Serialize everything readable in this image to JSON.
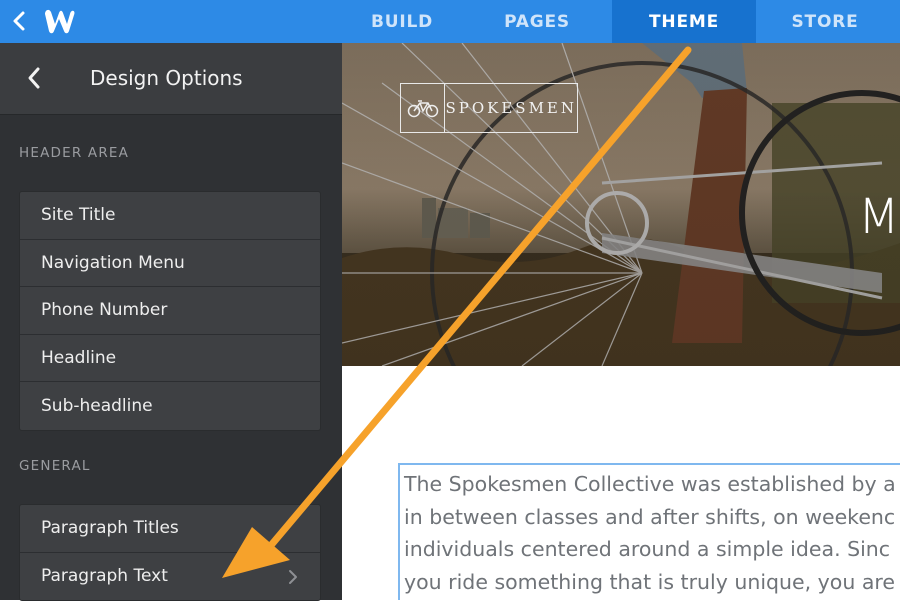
{
  "topbar": {
    "tabs": [
      {
        "label": "BUILD",
        "active": false
      },
      {
        "label": "PAGES",
        "active": false
      },
      {
        "label": "THEME",
        "active": true
      },
      {
        "label": "STORE",
        "active": false
      }
    ],
    "logo_icon": "weebly-w-icon",
    "back_icon": "chevron-left-icon"
  },
  "sidebar": {
    "title": "Design Options",
    "back_icon": "chevron-left-icon",
    "sections": [
      {
        "label": "HEADER AREA",
        "items": [
          "Site Title",
          "Navigation Menu",
          "Phone Number",
          "Headline",
          "Sub-headline"
        ]
      },
      {
        "label": "GENERAL",
        "items": [
          "Paragraph Titles",
          "Paragraph Text"
        ],
        "selected_item_chevron": "chevron-right-icon"
      }
    ]
  },
  "content": {
    "site_logo_text": "SPOKESMEN",
    "site_logo_icon": "bicycle-icon",
    "hero_heading_partial": "M",
    "paragraph_lines": [
      "The Spokesmen Collective was established by a",
      "in between classes and after shifts, on weekenc",
      "individuals centered around a simple idea. Sinc",
      "you ride something that is truly unique, you are"
    ]
  },
  "colors": {
    "topbar": "#2d8ae6",
    "topbar_active_tab": "#1772cf",
    "sidebar_bg": "#2f3134",
    "annotation_arrow": "#f6a22b",
    "selection_border": "#7fb8ef"
  }
}
